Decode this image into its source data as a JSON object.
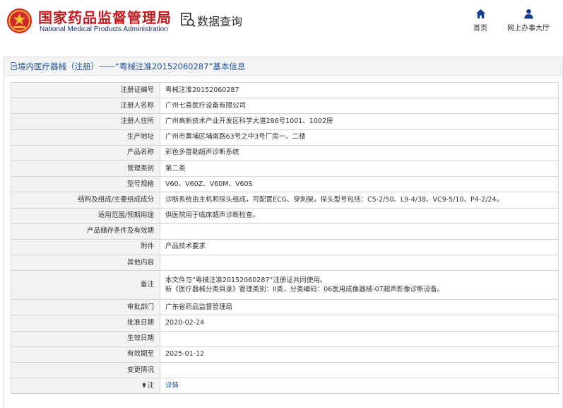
{
  "header": {
    "org_cn": "国家药品监督管理局",
    "org_en": "National Medical Products Administration",
    "db_title": "数据查询",
    "nav": [
      {
        "label": "首页",
        "icon": "home-icon"
      },
      {
        "label": "网上办事大厅",
        "icon": "user-icon"
      }
    ]
  },
  "panel": {
    "title": "境内医疗器械（注册）——“粤械注准20152060287”基本信息"
  },
  "record": [
    {
      "key": "注册证编号",
      "value": "粤械注准20152060287"
    },
    {
      "key": "注册人名称",
      "value": "广州七喜医疗设备有限公司"
    },
    {
      "key": "注册人住所",
      "value": "广州高新技术产业开发区科学大道286号1001、1002房"
    },
    {
      "key": "生产地址",
      "value": "广州市黄埔区埔南路63号之中3号厂房一、二楼"
    },
    {
      "key": "产品名称",
      "value": "彩色多普勒超声诊断系统"
    },
    {
      "key": "管理类别",
      "value": "第二类"
    },
    {
      "key": "型号规格",
      "value": "V60、V60Z、V60M、V60S"
    },
    {
      "key": "结构及组成/主要组成成分",
      "value": "诊断系统由主机和探头组成，可配置ECG、穿刺架。探头型号包括：C5-2/50、L9-4/38、VC9-5/10、P4-2/24。"
    },
    {
      "key": "适用范围/预期用途",
      "value": "供医院用于临床超声诊断检查。"
    },
    {
      "key": "产品储存条件及有效期",
      "value": ""
    },
    {
      "key": "附件",
      "value": "产品技术要求"
    },
    {
      "key": "其他内容",
      "value": ""
    },
    {
      "key": "备注",
      "value": "本文件与“粤械注准20152060287”注册证共同使用。",
      "value2": "新《医疗器械分类目录》管理类别：II类，分类编码：06医用成像器械-07超声影像诊断设备。"
    },
    {
      "key": "审批部门",
      "value": "广东省药品监督管理局"
    },
    {
      "key": "批准日期",
      "value": "2020-02-24"
    },
    {
      "key": "生效日期",
      "value": ""
    },
    {
      "key": "有效期至",
      "value": "2025-01-12"
    },
    {
      "key": "变更情况",
      "value": ""
    },
    {
      "key": "注",
      "value": "详情",
      "icon": "pin-icon"
    }
  ],
  "colors": {
    "brand_red": "#c0191f",
    "brand_blue": "#1b2f68",
    "link_blue": "#1d4f9c"
  }
}
